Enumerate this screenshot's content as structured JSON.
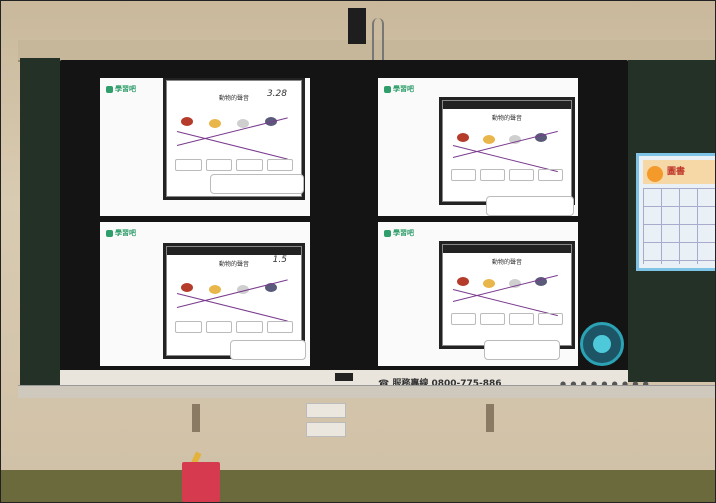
{
  "display": {
    "hotline_text": "☎ 服務專線 0800-775-886",
    "bottom_indicator": "● ● ● ● ● ● ● ● ●"
  },
  "panes": [
    {
      "id": "top-left",
      "logo": "學習吧",
      "sheet_title": "動物的聲音",
      "handwriting": "3.28"
    },
    {
      "id": "top-right",
      "logo": "學習吧",
      "sheet_title": "動物的聲音",
      "handwriting": ""
    },
    {
      "id": "bottom-left",
      "logo": "學習吧",
      "sheet_title": "動物的聲音",
      "handwriting": "1.5"
    },
    {
      "id": "bottom-right",
      "logo": "學習吧",
      "sheet_title": "動物的聲音",
      "handwriting": ""
    }
  ],
  "poster": {
    "title": "圖書"
  },
  "colors": {
    "accent_green": "#2f9e6a",
    "widget_teal": "#2ba3b4",
    "match_line_purple": "#7a3b8f"
  }
}
